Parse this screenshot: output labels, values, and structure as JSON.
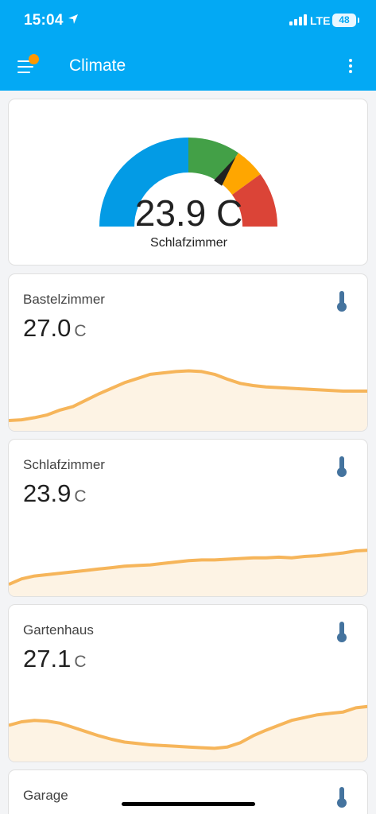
{
  "status_bar": {
    "time": "15:04",
    "network": "LTE",
    "battery": "48"
  },
  "toolbar": {
    "title": "Climate"
  },
  "gauge": {
    "value": "23.9 C",
    "name": "Schlafzimmer",
    "segment_colors": [
      "#039be5",
      "#43a047",
      "#ffa600",
      "#db4437"
    ],
    "needle_fraction": 0.69
  },
  "sensors": [
    {
      "name": "Bastelzimmer",
      "value": "27.0",
      "unit": "C",
      "history": [
        0.92,
        0.91,
        0.88,
        0.84,
        0.77,
        0.72,
        0.63,
        0.54,
        0.46,
        0.38,
        0.32,
        0.26,
        0.24,
        0.22,
        0.21,
        0.22,
        0.26,
        0.33,
        0.39,
        0.42,
        0.44,
        0.45,
        0.46,
        0.47,
        0.48,
        0.49,
        0.5,
        0.5,
        0.5
      ]
    },
    {
      "name": "Schlafzimmer",
      "value": "23.9",
      "unit": "C",
      "history": [
        0.9,
        0.82,
        0.78,
        0.76,
        0.74,
        0.72,
        0.7,
        0.68,
        0.66,
        0.64,
        0.63,
        0.62,
        0.6,
        0.58,
        0.56,
        0.55,
        0.55,
        0.54,
        0.53,
        0.52,
        0.52,
        0.51,
        0.52,
        0.5,
        0.49,
        0.47,
        0.45,
        0.42,
        0.41
      ]
    },
    {
      "name": "Gartenhaus",
      "value": "27.1",
      "unit": "C",
      "history": [
        0.55,
        0.5,
        0.48,
        0.49,
        0.52,
        0.58,
        0.64,
        0.7,
        0.75,
        0.79,
        0.81,
        0.83,
        0.84,
        0.85,
        0.86,
        0.87,
        0.88,
        0.86,
        0.8,
        0.7,
        0.62,
        0.55,
        0.48,
        0.44,
        0.4,
        0.38,
        0.36,
        0.3,
        0.28
      ]
    },
    {
      "name": "Garage",
      "value": "",
      "unit": ""
    }
  ]
}
